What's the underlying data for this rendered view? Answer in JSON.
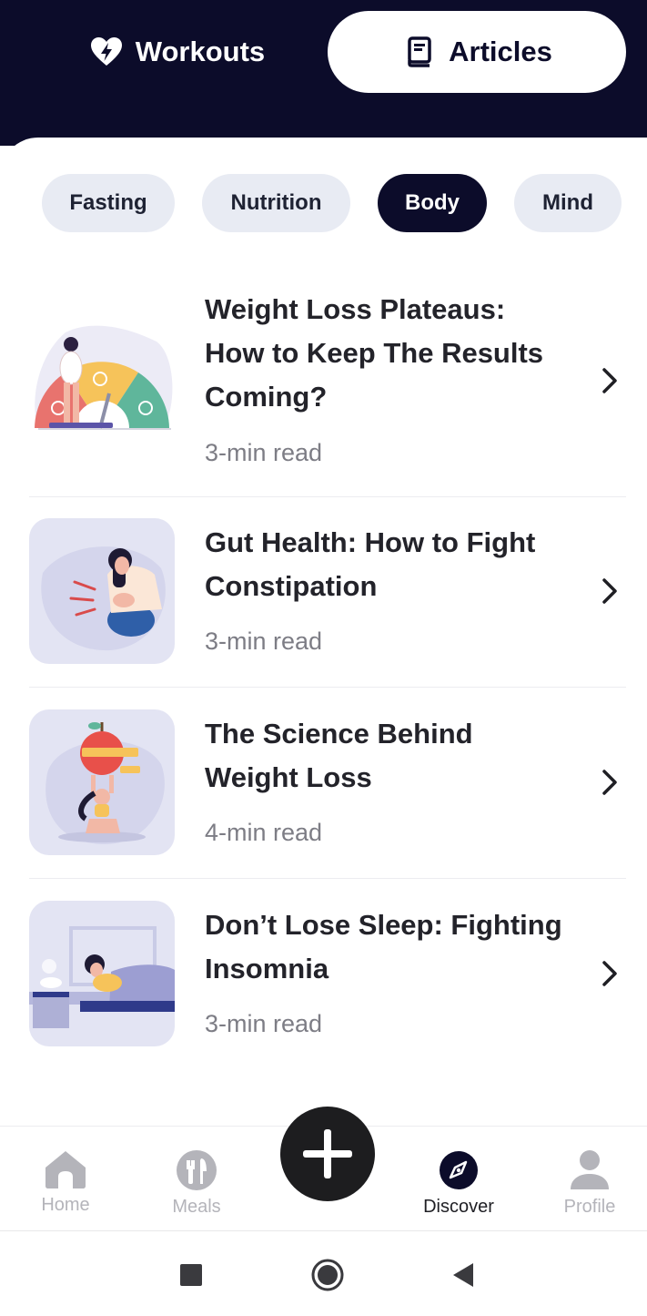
{
  "segments": {
    "workouts_label": "Workouts",
    "articles_label": "Articles",
    "active": "articles",
    "workouts_icon": "heart-bolt-icon",
    "articles_icon": "book-icon"
  },
  "chips": [
    {
      "label": "Fasting",
      "active": false
    },
    {
      "label": "Nutrition",
      "active": false
    },
    {
      "label": "Body",
      "active": true
    },
    {
      "label": "Mind",
      "active": false
    }
  ],
  "articles": [
    {
      "title_lines": [
        "Weight Loss Plateaus:",
        "How to Keep The Results",
        "Coming?"
      ],
      "read": "3-min read",
      "illustration": "woman-on-scale-gauge"
    },
    {
      "title_lines": [
        "Gut Health: How to Fight",
        "Constipation"
      ],
      "read": "3-min read",
      "illustration": "woman-stomach-ache"
    },
    {
      "title_lines": [
        "The Science Behind",
        "Weight Loss"
      ],
      "read": "4-min read",
      "illustration": "woman-holding-apple"
    },
    {
      "title_lines": [
        "Don’t Lose Sleep: Fighting",
        "Insomnia"
      ],
      "read": "3-min read",
      "illustration": "woman-in-bed"
    }
  ],
  "bottom_nav": {
    "home": "Home",
    "meals": "Meals",
    "discover": "Discover",
    "profile": "Profile",
    "active": "discover",
    "fab_icon": "plus-icon"
  },
  "system_nav": [
    "square-icon",
    "circle-home-icon",
    "back-triangle-icon"
  ],
  "colors": {
    "header_bg": "#0c0c2a",
    "chip_bg": "#e8ebf3",
    "chip_active_bg": "#0c0c2a",
    "muted_text": "#7d7d85",
    "nav_inactive": "#b4b4ba"
  }
}
